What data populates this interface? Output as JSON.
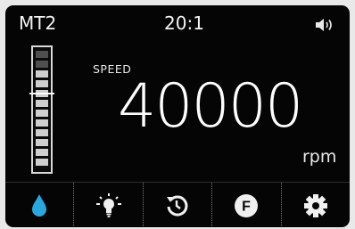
{
  "status_bar": {
    "model": "MT2",
    "ratio": "20:1",
    "volume_icon": "speaker-volume-icon"
  },
  "speed": {
    "label": "SPEED",
    "value": "40000",
    "unit": "rpm",
    "gauge_level_fraction": 0.85,
    "gauge_segments": 12
  },
  "controls": [
    {
      "name": "water-button",
      "icon": "water-drop-icon",
      "accent": "#29a8e0"
    },
    {
      "name": "light-button",
      "icon": "light-bulb-icon"
    },
    {
      "name": "reverse-button",
      "icon": "rotation-icon"
    },
    {
      "name": "favorite-button",
      "icon": "f-circle-icon",
      "letter": "F"
    },
    {
      "name": "settings-button",
      "icon": "gear-icon"
    }
  ],
  "colors": {
    "background": "#050505",
    "text": "#ffffff",
    "water_accent": "#29a8e0"
  }
}
